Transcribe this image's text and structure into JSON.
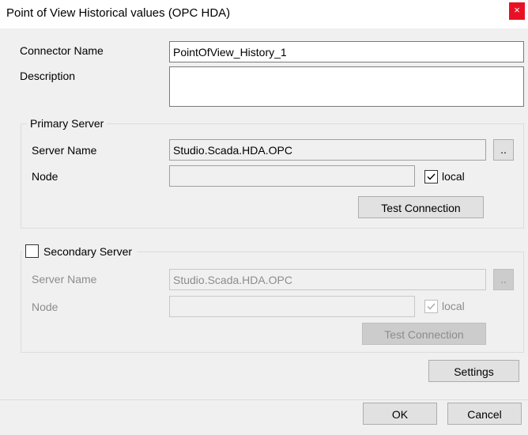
{
  "window": {
    "title": "Point of View Historical values (OPC HDA)",
    "close_glyph": "×"
  },
  "form": {
    "connector_name_label": "Connector Name",
    "connector_name_value": "PointOfView_History_1",
    "description_label": "Description",
    "description_value": ""
  },
  "primary": {
    "legend": "Primary Server",
    "server_name_label": "Server Name",
    "server_name_value": "Studio.Scada.HDA.OPC",
    "browse_label": "..",
    "node_label": "Node",
    "node_value": "",
    "local_label": "local",
    "local_checked": true,
    "test_label": "Test Connection"
  },
  "secondary": {
    "legend": "Secondary Server",
    "enabled": false,
    "server_name_label": "Server Name",
    "server_name_value": "Studio.Scada.HDA.OPC",
    "browse_label": "..",
    "node_label": "Node",
    "node_value": "",
    "local_label": "local",
    "local_checked": true,
    "test_label": "Test Connection"
  },
  "buttons": {
    "settings": "Settings",
    "ok": "OK",
    "cancel": "Cancel"
  },
  "colors": {
    "close_bg": "#e81123",
    "dialog_bg": "#f0f0f0",
    "disabled_text": "#8c8c8c"
  }
}
